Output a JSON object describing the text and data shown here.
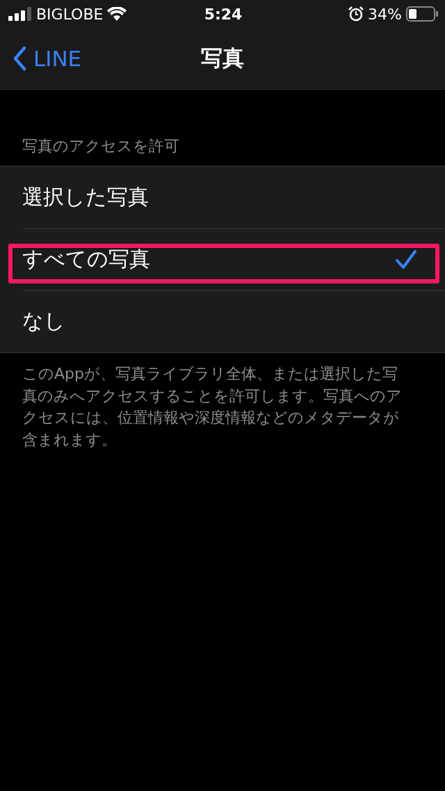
{
  "status_bar": {
    "carrier": "BIGLOBE",
    "time": "5:24",
    "battery": "34%"
  },
  "nav": {
    "back": "LINE",
    "title": "写真"
  },
  "section": {
    "header": "写真のアクセスを許可",
    "options": [
      {
        "label": "選択した写真",
        "selected": false,
        "highlighted": false
      },
      {
        "label": "すべての写真",
        "selected": true,
        "highlighted": true
      },
      {
        "label": "なし",
        "selected": false,
        "highlighted": false
      }
    ],
    "footer": "このAppが、写真ライブラリ全体、または選択した写真のみへアクセスすることを許可します。写真へのアクセスには、位置情報や深度情報などのメタデータが含まれます。"
  }
}
